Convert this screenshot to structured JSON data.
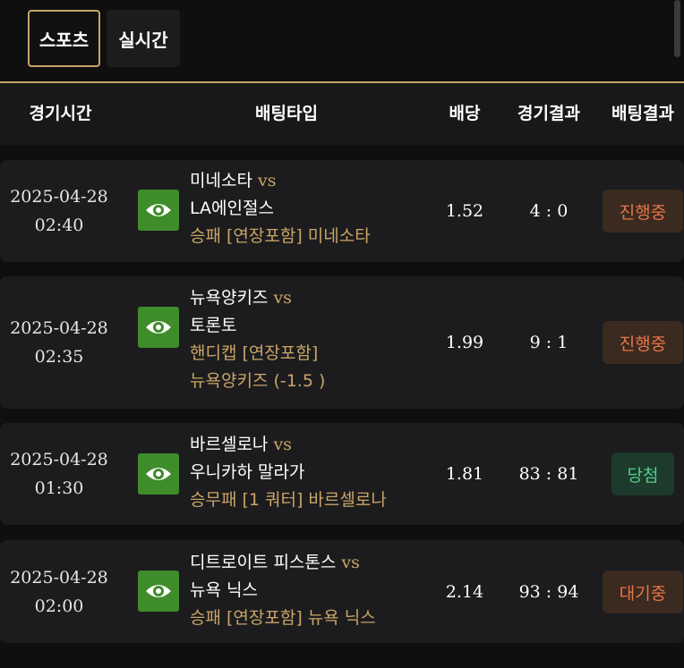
{
  "tabs": [
    {
      "label": "스포츠",
      "active": true
    },
    {
      "label": "실시간",
      "active": false
    }
  ],
  "colors": {
    "accent": "#c9a467",
    "eye_button": "#3f8c2a",
    "status_progress": "#e8744a",
    "status_win": "#4fd08b"
  },
  "header": {
    "time": "경기시간",
    "type": "배팅타입",
    "odds": "배당",
    "result": "경기결과",
    "bet_result": "배팅결과"
  },
  "rows": [
    {
      "date": "2025-04-28",
      "time": "02:40",
      "home": "미네소타",
      "vs": "vs",
      "away": "LA에인절스",
      "picks": [
        "승패 [연장포함] 미네소타"
      ],
      "odds": "1.52",
      "score": "4 : 0",
      "status": "진행중",
      "icon": "eye-icon"
    },
    {
      "date": "2025-04-28",
      "time": "02:35",
      "home": "뉴욕양키즈",
      "vs": "vs",
      "away": "토론토",
      "picks": [
        "핸디캡 [연장포함]",
        "뉴욕양키즈 (-1.5 )"
      ],
      "odds": "1.99",
      "score": "9 : 1",
      "status": "진행중",
      "icon": "eye-icon"
    },
    {
      "date": "2025-04-28",
      "time": "01:30",
      "home": "바르셀로나",
      "vs": "vs",
      "away": "우니카하 말라가",
      "picks": [
        "승무패 [1 쿼터] 바르셀로나"
      ],
      "odds": "1.81",
      "score": "83 : 81",
      "status": "당첨",
      "icon": "eye-icon"
    },
    {
      "date": "2025-04-28",
      "time": "02:00",
      "home": "디트로이트 피스톤스",
      "vs": "vs",
      "away": "뉴욕 닉스",
      "picks": [
        "승패 [연장포함] 뉴욕 닉스"
      ],
      "odds": "2.14",
      "score": "93 : 94",
      "status": "대기중",
      "icon": "eye-icon"
    }
  ]
}
